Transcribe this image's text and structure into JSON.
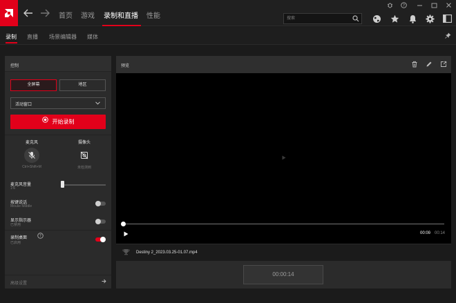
{
  "nav": {
    "tabs": [
      {
        "label": "首页"
      },
      {
        "label": "游戏"
      },
      {
        "label": "录制和直播"
      },
      {
        "label": "性能"
      }
    ],
    "search_placeholder": "搜索"
  },
  "subnav": {
    "tabs": [
      {
        "label": "录制"
      },
      {
        "label": "直播"
      },
      {
        "label": "场景编辑器"
      },
      {
        "label": "媒体"
      }
    ]
  },
  "control": {
    "title": "控制",
    "mode_fullscreen": "全屏幕",
    "mode_region": "地区",
    "dropdown_value": "活动窗口",
    "record_label": "开始录制",
    "mic": {
      "label": "麦克风",
      "hotkey": "Ctrl+Shift+M"
    },
    "camera": {
      "label": "摄像头",
      "status": "未检测到"
    },
    "mic_volume": {
      "title": "麦克风音量",
      "value": "1%",
      "level": 0.01
    },
    "push_to_talk": {
      "title": "按键说话",
      "sub": "Mouse Middle",
      "on": false
    },
    "show_indicator": {
      "title": "显示指示器",
      "sub": "已禁用",
      "on": false
    },
    "record_desktop": {
      "title": "录制桌面",
      "sub": "已启用",
      "on": true
    },
    "advanced": "高级设置"
  },
  "preview": {
    "title": "预览",
    "time_current": "00:00",
    "time_sep": "/",
    "time_total": "00:14",
    "progress": 0.0
  },
  "file": {
    "name": "Destiny 2_2023.03.25-01.07.mp4"
  },
  "timer": "00:00:14",
  "colors": {
    "accent": "#e2001a",
    "bg": "#1b1b1b",
    "panel": "#2b2b2b"
  }
}
